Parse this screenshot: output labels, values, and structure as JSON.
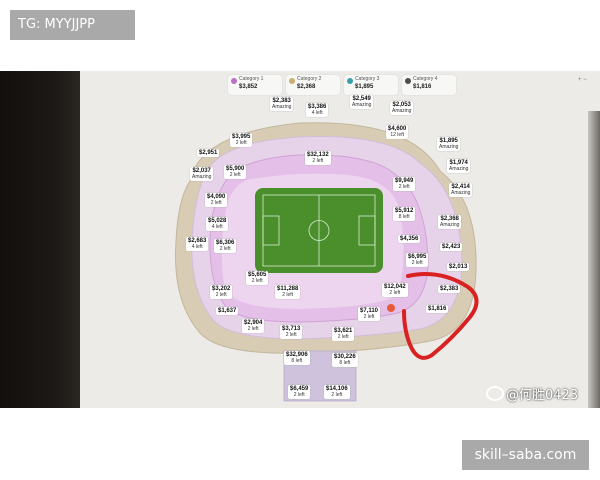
{
  "watermark_top": "TG: MYYJJPP",
  "watermark_bottom": "skill–saba.com",
  "weibo_handle": "@何胜0423",
  "legend": [
    {
      "name": "Category 1",
      "price": "$3,852",
      "color": "#b86fc4"
    },
    {
      "name": "Category 2",
      "price": "$2,368",
      "color": "#c9ae6d"
    },
    {
      "name": "Category 3",
      "price": "$1,895",
      "color": "#3aa0a8"
    },
    {
      "name": "Category 4",
      "price": "$1,816",
      "color": "#4e4e4e"
    }
  ],
  "screen_controls": "+ −",
  "price_pills": [
    {
      "price": "$2,383",
      "note": "Amazing"
    },
    {
      "price": "$3,386",
      "note": "4 left"
    },
    {
      "price": "$2,549",
      "note": "Amazing"
    },
    {
      "price": "$2,053",
      "note": "Amazing"
    },
    {
      "price": "$4,600",
      "note": "12 left"
    },
    {
      "price": "$3,995",
      "note": "2 left"
    },
    {
      "price": "$2,951",
      "note": ""
    },
    {
      "price": "$1,895",
      "note": "Amazing"
    },
    {
      "price": "$32,132",
      "note": "2 left"
    },
    {
      "price": "$1,974",
      "note": "Amazing"
    },
    {
      "price": "$5,900",
      "note": "2 left"
    },
    {
      "price": "$2,037",
      "note": "Amazing"
    },
    {
      "price": "$9,949",
      "note": "2 left"
    },
    {
      "price": "$2,414",
      "note": "Amazing"
    },
    {
      "price": "$4,090",
      "note": "2 left"
    },
    {
      "price": "$5,912",
      "note": "8 left"
    },
    {
      "price": "$5,028",
      "note": "4 left"
    },
    {
      "price": "$2,368",
      "note": "Amazing"
    },
    {
      "price": "$4,356",
      "note": ""
    },
    {
      "price": "$2,683",
      "note": "4 left"
    },
    {
      "price": "$6,306",
      "note": "2 left"
    },
    {
      "price": "$2,423",
      "note": ""
    },
    {
      "price": "$6,995",
      "note": "2 left"
    },
    {
      "price": "$2,013",
      "note": ""
    },
    {
      "price": "$5,605",
      "note": "2 left"
    },
    {
      "price": "$3,202",
      "note": "2 left"
    },
    {
      "price": "$11,288",
      "note": "2 left"
    },
    {
      "price": "$12,042",
      "note": "2 left"
    },
    {
      "price": "$2,383",
      "note": ""
    },
    {
      "price": "$1,637",
      "note": ""
    },
    {
      "price": "$7,110",
      "note": "2 left"
    },
    {
      "price": "$1,816",
      "note": ""
    },
    {
      "price": "$2,904",
      "note": "2 left"
    },
    {
      "price": "$3,713",
      "note": "2 left"
    },
    {
      "price": "$3,621",
      "note": "2 left"
    },
    {
      "price": "$32,906",
      "note": "8 left"
    },
    {
      "price": "$30,226",
      "note": "8 left"
    },
    {
      "price": "$6,459",
      "note": "2 left"
    },
    {
      "price": "$14,106",
      "note": "2 left"
    }
  ]
}
